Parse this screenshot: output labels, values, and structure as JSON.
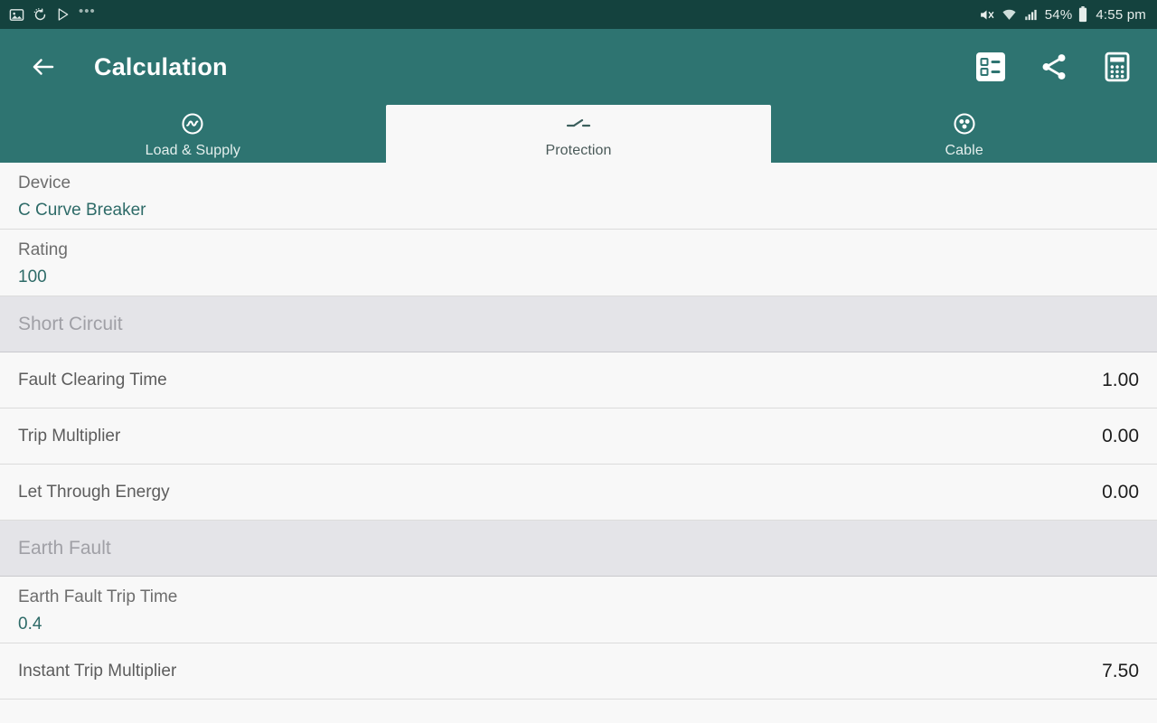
{
  "status_bar": {
    "icons": [
      "image-icon",
      "bluetooth-sync-icon",
      "play-store-icon",
      "more-dots-icon"
    ],
    "mute_icon": "volume-mute-icon",
    "wifi_icon": "wifi-icon",
    "signal_icon": "cellular-signal-icon",
    "battery_percent": "54%",
    "battery_icon": "battery-icon",
    "time": "4:55 pm"
  },
  "app_bar": {
    "back_icon": "back-arrow-icon",
    "title": "Calculation",
    "actions": [
      {
        "name": "list-view-icon"
      },
      {
        "name": "share-icon"
      },
      {
        "name": "calculator-icon"
      }
    ]
  },
  "tabs": [
    {
      "label": "Load & Supply",
      "icon": "ac-source-icon",
      "selected": false
    },
    {
      "label": "Protection",
      "icon": "circuit-breaker-icon",
      "selected": true
    },
    {
      "label": "Cable",
      "icon": "cable-core-icon",
      "selected": false
    }
  ],
  "list": [
    {
      "type": "two-line",
      "label": "Device",
      "value": "C Curve Breaker"
    },
    {
      "type": "two-line",
      "label": "Rating",
      "value": "100"
    },
    {
      "type": "section",
      "label": "Short Circuit"
    },
    {
      "type": "one-line",
      "label": "Fault Clearing Time",
      "value": "1.00"
    },
    {
      "type": "one-line",
      "label": "Trip Multiplier",
      "value": "0.00"
    },
    {
      "type": "one-line",
      "label": "Let Through Energy",
      "value": "0.00"
    },
    {
      "type": "section",
      "label": "Earth Fault"
    },
    {
      "type": "two-line",
      "label": "Earth Fault Trip Time",
      "value": "0.4"
    },
    {
      "type": "one-line",
      "label": "Instant Trip Multiplier",
      "value": "7.50"
    }
  ],
  "colors": {
    "status_bar": "#14423E",
    "app_bar": "#2E7471",
    "accent_value": "#2E6B68",
    "section_band": "#E4E4E8",
    "row_background": "#F8F8F8"
  }
}
